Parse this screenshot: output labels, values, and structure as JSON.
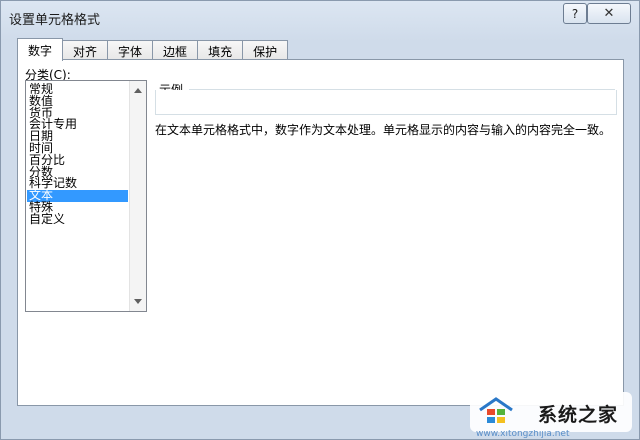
{
  "window": {
    "title": "设置单元格格式",
    "help_label": "?"
  },
  "tabs": [
    {
      "label": "数字",
      "active": true
    },
    {
      "label": "对齐",
      "active": false
    },
    {
      "label": "字体",
      "active": false
    },
    {
      "label": "边框",
      "active": false
    },
    {
      "label": "填充",
      "active": false
    },
    {
      "label": "保护",
      "active": false
    }
  ],
  "category": {
    "label": "分类(C):",
    "items": [
      "常规",
      "数值",
      "货币",
      "会计专用",
      "日期",
      "时间",
      "百分比",
      "分数",
      "科学记数",
      "文本",
      "特殊",
      "自定义"
    ],
    "selected": "文本"
  },
  "sample": {
    "label": "示例",
    "value": ""
  },
  "description": "在文本单元格格式中，数字作为文本处理。单元格显示的内容与输入的内容完全一致。",
  "watermark": {
    "text": "系统之家",
    "url": "www.xitongzhijia.net"
  },
  "icons": {
    "close": "close-icon",
    "help": "help-icon",
    "scroll_up": "scroll-up-arrow-icon",
    "scroll_down": "scroll-down-arrow-icon",
    "logo": "windows-house-logo-icon"
  },
  "colors": {
    "selection": "#3399ff",
    "dialog_background": "#cfdbea"
  }
}
